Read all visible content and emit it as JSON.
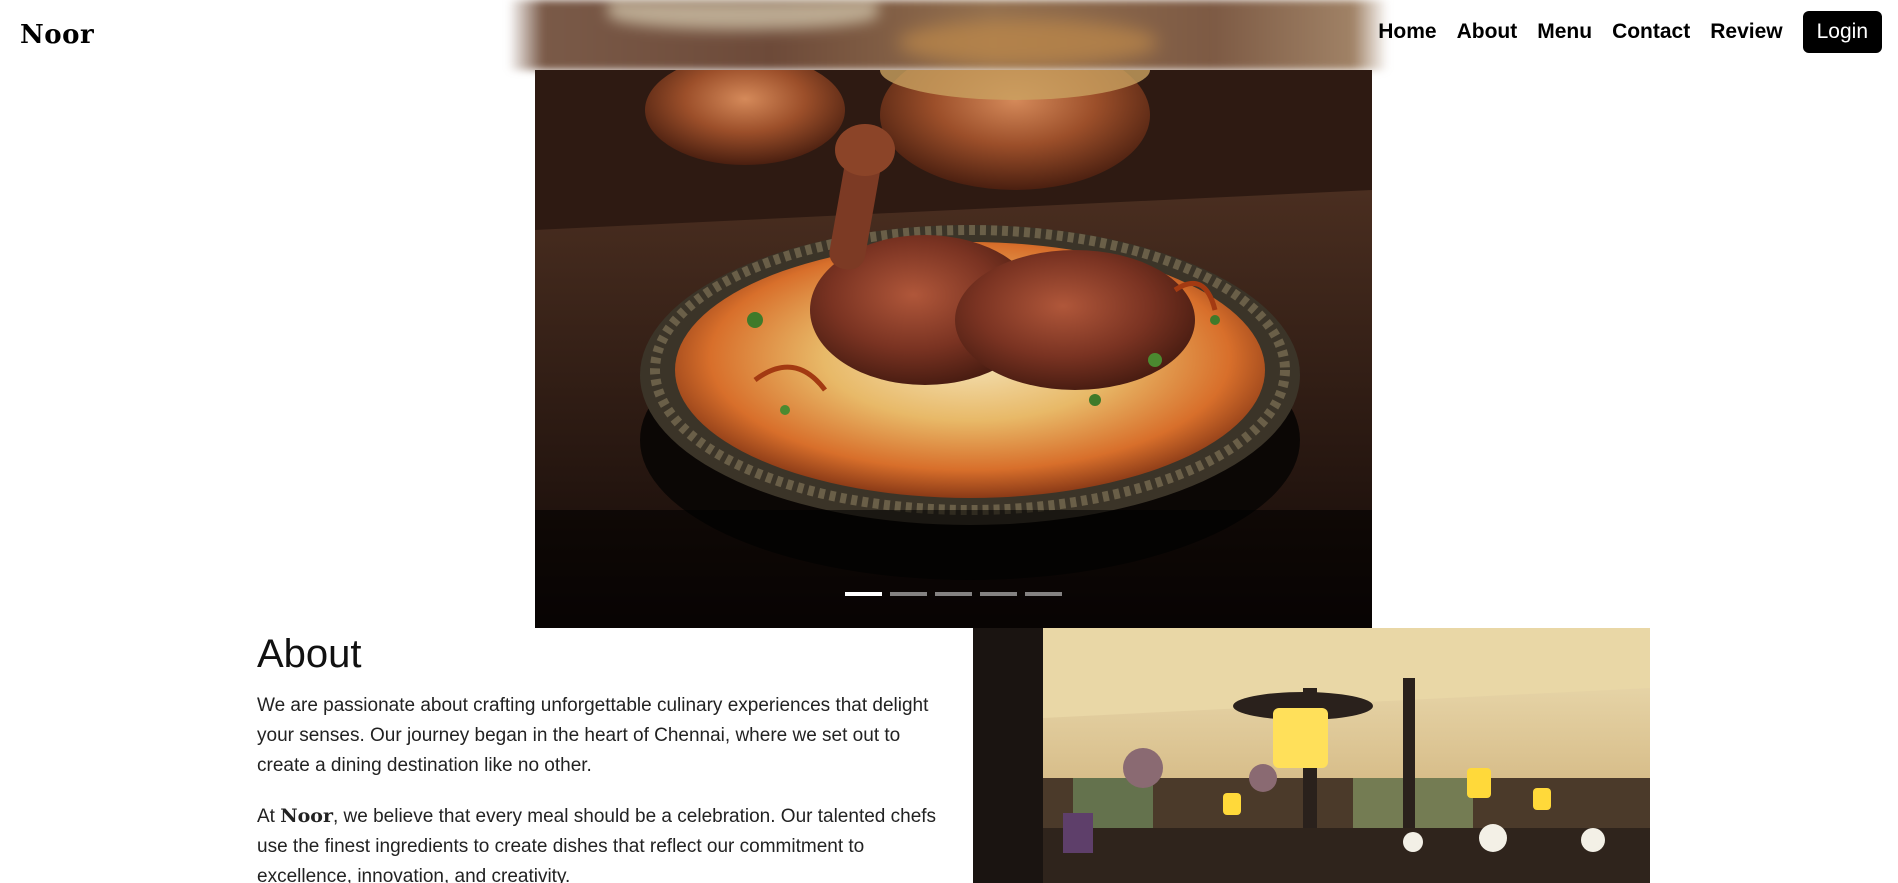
{
  "navbar": {
    "brand": "Noor",
    "links": [
      "Home",
      "About",
      "Menu",
      "Contact",
      "Review"
    ],
    "login_label": "Login"
  },
  "hero": {
    "slide_count": 5,
    "active_index": 0
  },
  "about": {
    "title": "About",
    "paragraph1": "We are passionate about crafting unforgettable culinary experiences that delight your senses. Our journey began in the heart of Chennai, where we set out to create a dining destination like no other.",
    "paragraph2_prefix": "At ",
    "paragraph2_brand": "Noor",
    "paragraph2_suffix": ", we believe that every meal should be a celebration. Our talented chefs use the finest ingredients to create dishes that reflect our commitment to excellence, innovation, and creativity."
  },
  "colors": {
    "nav_text": "#000000",
    "login_bg": "#000000",
    "login_text": "#ffffff",
    "page_bg": "#ffffff"
  }
}
